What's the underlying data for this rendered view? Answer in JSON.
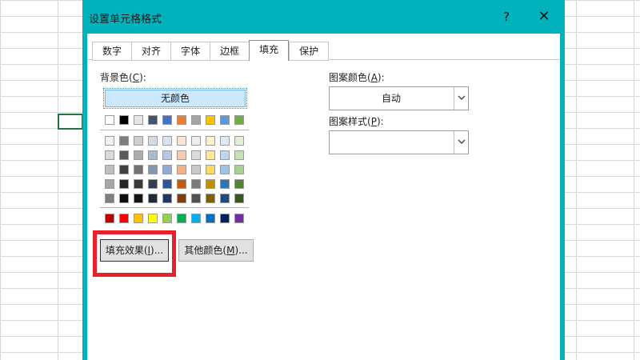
{
  "dialog": {
    "title": "设置单元格格式",
    "help_label": "?",
    "close_label": "✕"
  },
  "tabs": [
    {
      "label": "数字",
      "active": false
    },
    {
      "label": "对齐",
      "active": false
    },
    {
      "label": "字体",
      "active": false
    },
    {
      "label": "边框",
      "active": false
    },
    {
      "label": "填充",
      "active": true
    },
    {
      "label": "保护",
      "active": false
    }
  ],
  "fill": {
    "background_label": "背景色(",
    "background_key": "C",
    "background_suffix": "):",
    "no_color_label": "无颜色",
    "theme_top_row": [
      "#ffffff",
      "#000000",
      "#e7e6e6",
      "#44546a",
      "#4472c4",
      "#ed7d31",
      "#a5a5a5",
      "#ffc000",
      "#5b9bd5",
      "#70ad47"
    ],
    "theme_shades": [
      [
        "#f2f2f2",
        "#7f7f7f",
        "#d0cece",
        "#d6dce5",
        "#dae3f3",
        "#fbe5d6",
        "#ededed",
        "#fff2cc",
        "#deebf7",
        "#e2f0d9"
      ],
      [
        "#d9d9d9",
        "#595959",
        "#aeabab",
        "#adb9ca",
        "#b4c7e7",
        "#f8cbad",
        "#dbdbdb",
        "#ffe699",
        "#bdd7ee",
        "#c5e0b4"
      ],
      [
        "#bfbfbf",
        "#404040",
        "#757171",
        "#8497b0",
        "#8faadc",
        "#f4b183",
        "#c9c9c9",
        "#ffd966",
        "#9dc3e6",
        "#a9d18e"
      ],
      [
        "#a6a6a6",
        "#262626",
        "#3a3838",
        "#333f50",
        "#2f5597",
        "#c55a11",
        "#7b7b7b",
        "#bf9000",
        "#2e75b6",
        "#548235"
      ],
      [
        "#7f7f7f",
        "#0d0d0d",
        "#171616",
        "#222a35",
        "#203864",
        "#843c0c",
        "#525252",
        "#7f6000",
        "#1f4e79",
        "#385723"
      ]
    ],
    "standard_colors": [
      "#c00000",
      "#ff0000",
      "#ffc000",
      "#ffff00",
      "#92d050",
      "#00b050",
      "#00b0f0",
      "#0070c0",
      "#002060",
      "#7030a0"
    ],
    "fill_effects_label": "填充效果(",
    "fill_effects_key": "I",
    "fill_effects_suffix": ")...",
    "other_colors_label": "其他颜色(",
    "other_colors_key": "M",
    "other_colors_suffix": ")..."
  },
  "pattern": {
    "color_label": "图案颜色(",
    "color_key": "A",
    "color_suffix": "):",
    "color_value": "自动",
    "style_label": "图案样式(",
    "style_key": "P",
    "style_suffix": "):",
    "style_value": ""
  },
  "colors": {
    "title_bar": "#01b2bd",
    "highlight": "#e8202a",
    "selected_cell": "#217346"
  }
}
